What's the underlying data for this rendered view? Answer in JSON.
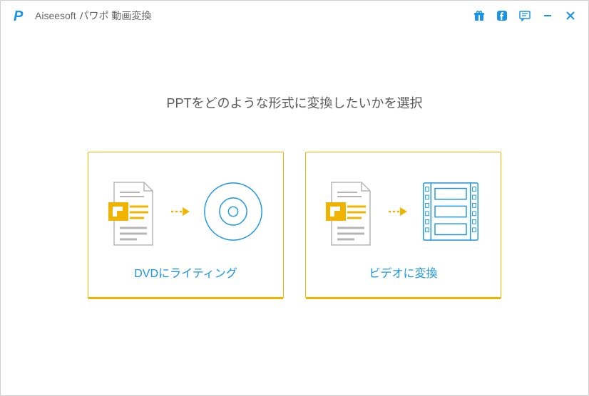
{
  "colors": {
    "accent_blue": "#1a94e6",
    "accent_yellow": "#f0b400",
    "line_gray": "#b6b6b6",
    "text_gray": "#5a5a5a"
  },
  "app": {
    "title": "Aiseesoft パワポ 動画変換"
  },
  "main": {
    "heading": "PPTをどのような形式に変換したいかを選択"
  },
  "cards": {
    "dvd": {
      "label": "DVDにライティング"
    },
    "video": {
      "label": "ビデオに変換"
    }
  }
}
